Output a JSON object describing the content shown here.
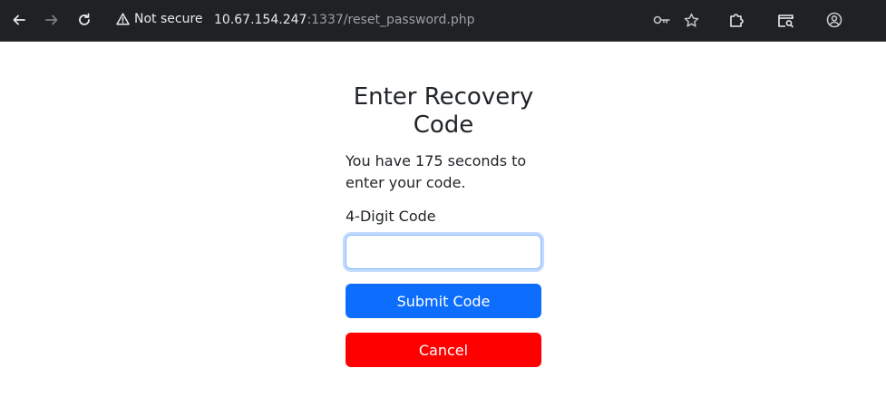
{
  "browser": {
    "security_label": "Not secure",
    "url_host": "10.67.154.247",
    "url_path": ":1337/reset_password.php",
    "icons": {
      "back": "arrow-left-icon",
      "forward": "arrow-right-icon",
      "reload": "reload-icon",
      "warning": "warning-icon",
      "key": "key-icon",
      "star": "star-icon",
      "extensions": "puzzle-icon",
      "tab_search": "tab-search-icon",
      "profile": "profile-icon"
    }
  },
  "page": {
    "title": "Enter Recovery Code",
    "description": "You have 175 seconds to enter your code.",
    "code_label": "4-Digit Code",
    "code_value": "",
    "submit_label": "Submit Code",
    "cancel_label": "Cancel"
  },
  "colors": {
    "primary": "#0d6efd",
    "cancel": "#ff0000",
    "topbar": "#202124"
  }
}
